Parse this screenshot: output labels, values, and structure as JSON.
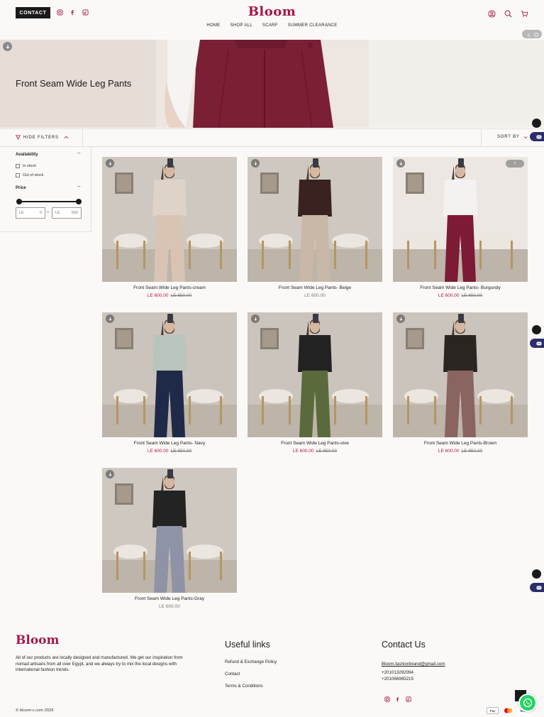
{
  "header": {
    "contact_label": "CONTACT",
    "logo": "Bloom",
    "nav": [
      "HOME",
      "SHOP ALL",
      "SCARF",
      "SUMMER CLEARANCE"
    ],
    "social_icons": [
      "instagram-icon",
      "facebook-icon",
      "tiktok-icon"
    ],
    "right_icons": [
      "account-icon",
      "search-icon",
      "cart-icon"
    ]
  },
  "hero": {
    "title": "Front Seam Wide Leg Pants",
    "badge": "6"
  },
  "toolbar": {
    "hide_filters": "HIDE FILTERS",
    "sort_by": "SORT BY"
  },
  "filters": {
    "availability_label": "Availability",
    "in_stock": "In stock",
    "out_of_stock": "Out of stock",
    "price_label": "Price",
    "currency": "LE",
    "min": "0",
    "max": "600"
  },
  "products": [
    {
      "name": "Front Seam Wide Leg Pants-cream",
      "price": "LE 600.00",
      "compare": "LE 850.00",
      "on_sale": true,
      "top": "#ddd3c8",
      "pants": "#d9c4b4",
      "bg": "#cfc8c0"
    },
    {
      "name": "Front Seam Wide Leg Pants- Beige",
      "price": "LE 600.00",
      "compare": "",
      "on_sale": false,
      "top": "#3a2220",
      "pants": "#c9b8a8",
      "bg": "#cfc8c0"
    },
    {
      "name": "Front Seam Wide Leg Pants- Burgundy",
      "price": "LE 600.00",
      "compare": "LE 850.00",
      "on_sale": true,
      "top": "#f4f2f0",
      "pants": "#7d1a35",
      "bg": "#ece7e2",
      "badge": "7"
    },
    {
      "name": "Front Seam Wide Leg Pants- Navy",
      "price": "LE 600.00",
      "compare": "LE 850.00",
      "on_sale": true,
      "top": "#b9c4bc",
      "pants": "#1e2a48",
      "bg": "#cbc4bc"
    },
    {
      "name": "Front Seam Wide Leg Pants-oive",
      "price": "LE 600.00",
      "compare": "LE 850.00",
      "on_sale": true,
      "top": "#222222",
      "pants": "#5b6a3c",
      "bg": "#cbc4bc"
    },
    {
      "name": "Front Seam Wide Leg Pants-Brown",
      "price": "LE 600.00",
      "compare": "LE 850.00",
      "on_sale": true,
      "top": "#2b2522",
      "pants": "#8a6460",
      "bg": "#cbc4bc"
    },
    {
      "name": "Front Seam Wide Leg Pants-Gray",
      "price": "LE 600.00",
      "compare": "",
      "on_sale": false,
      "top": "#232323",
      "pants": "#8e93a6",
      "bg": "#cfc8c0"
    }
  ],
  "footer": {
    "logo": "Bloom",
    "description": "All of our products are locally designed and manufactured. We get our inspiration from nomad artisans from all over Egypt, and we always try to mix the local designs with international fashion trends.",
    "useful_links_title": "Useful links",
    "links": [
      "Refund & Exchange Policy",
      "Contact",
      "Terms & Conditions"
    ],
    "contact_title": "Contact Us",
    "email": "Bloom.fashionbrand@gmail.com",
    "phone1": "+201013292094",
    "phone2": "+201066965215",
    "copyright": "© bloom-c.com 2026",
    "payments": [
      "Pay",
      "",
      "VISA"
    ]
  },
  "colors": {
    "brand": "#a3184a",
    "sale": "#b5173e",
    "background": "#fbf9f7"
  }
}
